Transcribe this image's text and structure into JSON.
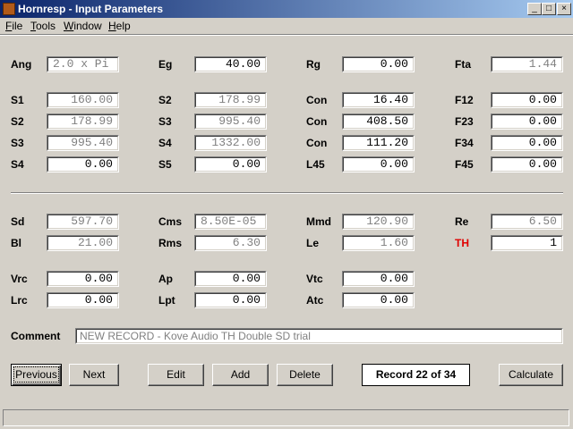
{
  "window": {
    "title": "Hornresp - Input Parameters",
    "controls": {
      "minimize": "_",
      "maximize": "□",
      "close": "×"
    }
  },
  "menu": [
    {
      "label": "File",
      "accel": "F",
      "rest": "ile"
    },
    {
      "label": "Tools",
      "accel": "T",
      "rest": "ools"
    },
    {
      "label": "Window",
      "accel": "W",
      "rest": "indow"
    },
    {
      "label": "Help",
      "accel": "H",
      "rest": "elp"
    }
  ],
  "fields": {
    "ang": {
      "label": "Ang",
      "value": "2.0 x Pi"
    },
    "eg": {
      "label": "Eg",
      "value": "40.00"
    },
    "rg": {
      "label": "Rg",
      "value": "0.00"
    },
    "fta": {
      "label": "Fta",
      "value": "1.44"
    },
    "r1_s1": {
      "label": "S1",
      "value": "160.00"
    },
    "r1_s2": {
      "label": "S2",
      "value": "178.99"
    },
    "r1_con": {
      "label": "Con",
      "value": "16.40"
    },
    "r1_f12": {
      "label": "F12",
      "value": "0.00"
    },
    "r2_s2": {
      "label": "S2",
      "value": "178.99"
    },
    "r2_s3": {
      "label": "S3",
      "value": "995.40"
    },
    "r2_con": {
      "label": "Con",
      "value": "408.50"
    },
    "r2_f23": {
      "label": "F23",
      "value": "0.00"
    },
    "r3_s3": {
      "label": "S3",
      "value": "995.40"
    },
    "r3_s4": {
      "label": "S4",
      "value": "1332.00"
    },
    "r3_con": {
      "label": "Con",
      "value": "111.20"
    },
    "r3_f34": {
      "label": "F34",
      "value": "0.00"
    },
    "r4_s4": {
      "label": "S4",
      "value": "0.00"
    },
    "r4_s5": {
      "label": "S5",
      "value": "0.00"
    },
    "r4_l45": {
      "label": "L45",
      "value": "0.00"
    },
    "r4_f45": {
      "label": "F45",
      "value": "0.00"
    },
    "sd": {
      "label": "Sd",
      "value": "597.70"
    },
    "cms": {
      "label": "Cms",
      "value": "8.50E-05"
    },
    "mmd": {
      "label": "Mmd",
      "value": "120.90"
    },
    "re": {
      "label": "Re",
      "value": "6.50"
    },
    "bl": {
      "label": "Bl",
      "value": "21.00"
    },
    "rms": {
      "label": "Rms",
      "value": "6.30"
    },
    "le": {
      "label": "Le",
      "value": "1.60"
    },
    "th": {
      "label": "TH",
      "value": "1",
      "label_color": "#e00000"
    },
    "vrc": {
      "label": "Vrc",
      "value": "0.00"
    },
    "ap": {
      "label": "Ap",
      "value": "0.00"
    },
    "vtc": {
      "label": "Vtc",
      "value": "0.00"
    },
    "lrc": {
      "label": "Lrc",
      "value": "0.00"
    },
    "lpt": {
      "label": "Lpt",
      "value": "0.00"
    },
    "atc": {
      "label": "Atc",
      "value": "0.00"
    }
  },
  "comment": {
    "label": "Comment",
    "value": "NEW RECORD - Kove Audio TH Double SD trial"
  },
  "buttons": {
    "previous": {
      "label": "Previous"
    },
    "next": {
      "label": "Next"
    },
    "edit": {
      "label": "Edit"
    },
    "add": {
      "label": "Add"
    },
    "delete": {
      "label": "Delete"
    },
    "calculate": {
      "label": "Calculate"
    }
  },
  "record_indicator": "Record 22 of 34",
  "status_text": ""
}
